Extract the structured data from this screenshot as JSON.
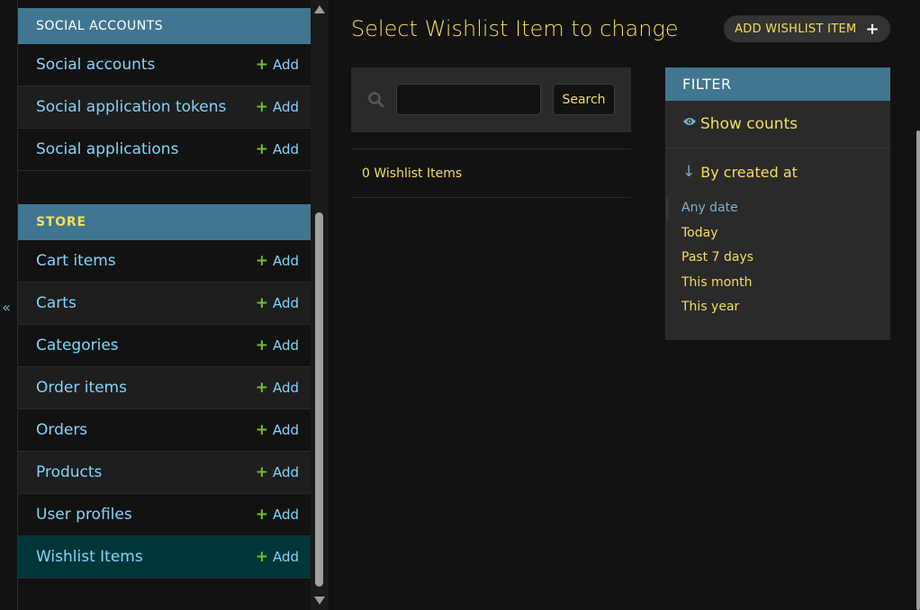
{
  "sidebar": {
    "toggle_icon": "«",
    "social": {
      "caption": "SOCIAL ACCOUNTS",
      "items": [
        {
          "label": "Social accounts",
          "add": "Add"
        },
        {
          "label": "Social application tokens",
          "add": "Add"
        },
        {
          "label": "Social applications",
          "add": "Add"
        }
      ]
    },
    "store": {
      "caption": "STORE",
      "items": [
        {
          "label": "Cart items",
          "add": "Add"
        },
        {
          "label": "Carts",
          "add": "Add"
        },
        {
          "label": "Categories",
          "add": "Add"
        },
        {
          "label": "Order items",
          "add": "Add"
        },
        {
          "label": "Orders",
          "add": "Add"
        },
        {
          "label": "Products",
          "add": "Add"
        },
        {
          "label": "User profiles",
          "add": "Add"
        },
        {
          "label": "Wishlist Items",
          "add": "Add"
        }
      ]
    },
    "plus_icon": "+"
  },
  "main": {
    "title": "Select Wishlist Item to change",
    "add_button": "ADD WISHLIST ITEM",
    "add_button_icon": "+",
    "search": {
      "value": "",
      "button": "Search"
    },
    "result_count": "0 Wishlist Items"
  },
  "filter": {
    "header": "FILTER",
    "show_counts": "Show counts",
    "by_title": "By created at",
    "options": [
      "Any date",
      "Today",
      "Past 7 days",
      "This month",
      "This year"
    ],
    "selected": "Any date"
  },
  "colors": {
    "accent": "#417690",
    "link": "#81d4fa",
    "text": "#f5dd5d",
    "add_plus": "#70bf2b"
  }
}
